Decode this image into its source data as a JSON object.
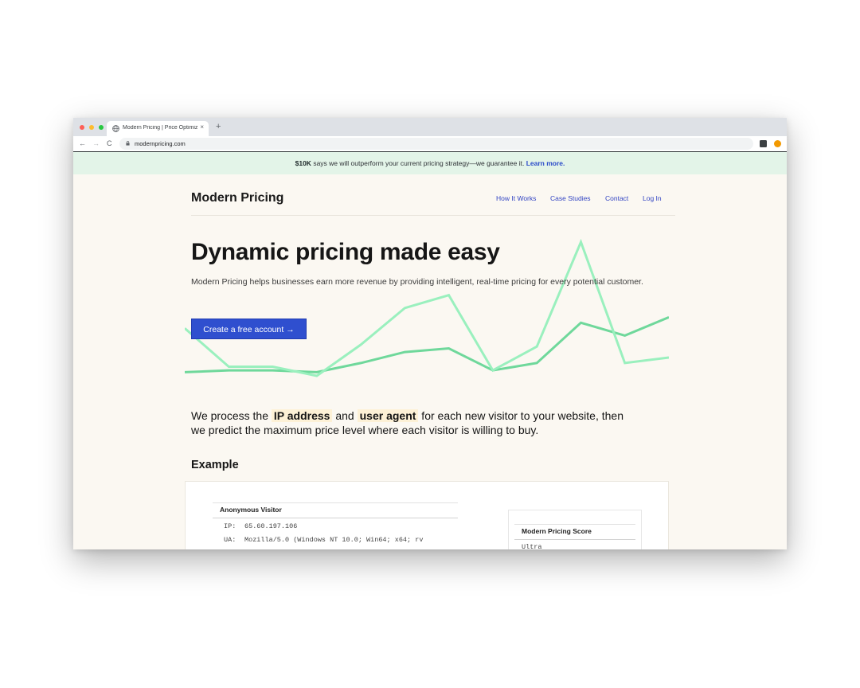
{
  "browser": {
    "tab_title": "Modern Pricing | Price Optimiz",
    "tab_close": "×",
    "new_tab": "+",
    "url": "modernpricing.com",
    "nav": {
      "back": "←",
      "forward": "→",
      "reload": "C"
    }
  },
  "banner": {
    "strong": "$10K",
    "text": " says we will outperform your current pricing strategy—we guarantee it. ",
    "link": "Learn more."
  },
  "header": {
    "brand": "Modern Pricing",
    "nav": [
      "How It Works",
      "Case Studies",
      "Contact",
      "Log In"
    ]
  },
  "hero": {
    "title": "Dynamic pricing made easy",
    "subtitle": "Modern Pricing helps businesses earn more revenue by providing intelligent, real-time pricing for every potential customer.",
    "cta": "Create a free account →"
  },
  "process": {
    "line1_pre": "We process the ",
    "highlight1": "IP address",
    "line1_mid": " and ",
    "highlight2": "user agent",
    "line1_post": " for each new visitor to your website, then",
    "line2": "we predict the maximum price level where each visitor is willing to buy."
  },
  "example": {
    "heading": "Example",
    "visitor": {
      "title": "Anonymous Visitor",
      "rows": [
        {
          "key": "IP:",
          "value": "65.60.197.106"
        },
        {
          "key": "UA:",
          "value": "Mozilla/5.0 (Windows NT 10.0; Win64; x64; rv"
        }
      ]
    },
    "score": {
      "title": "Modern Pricing Score",
      "value": "Ultra"
    }
  },
  "colors": {
    "accent": "#2f4fcf",
    "banner_bg": "#e3f4e8",
    "page_bg": "#fbf8f2",
    "line_dark": "#6fd89b",
    "line_light": "#9af0be"
  },
  "chart_data": {
    "type": "line",
    "series": [
      {
        "values": [
          22,
          1,
          1,
          -4,
          13,
          33,
          40,
          -1,
          12,
          69,
          3,
          6
        ]
      },
      {
        "values": [
          -2,
          -1,
          -1,
          -2,
          3,
          9,
          11,
          -1,
          3,
          25,
          18,
          28
        ]
      }
    ]
  }
}
